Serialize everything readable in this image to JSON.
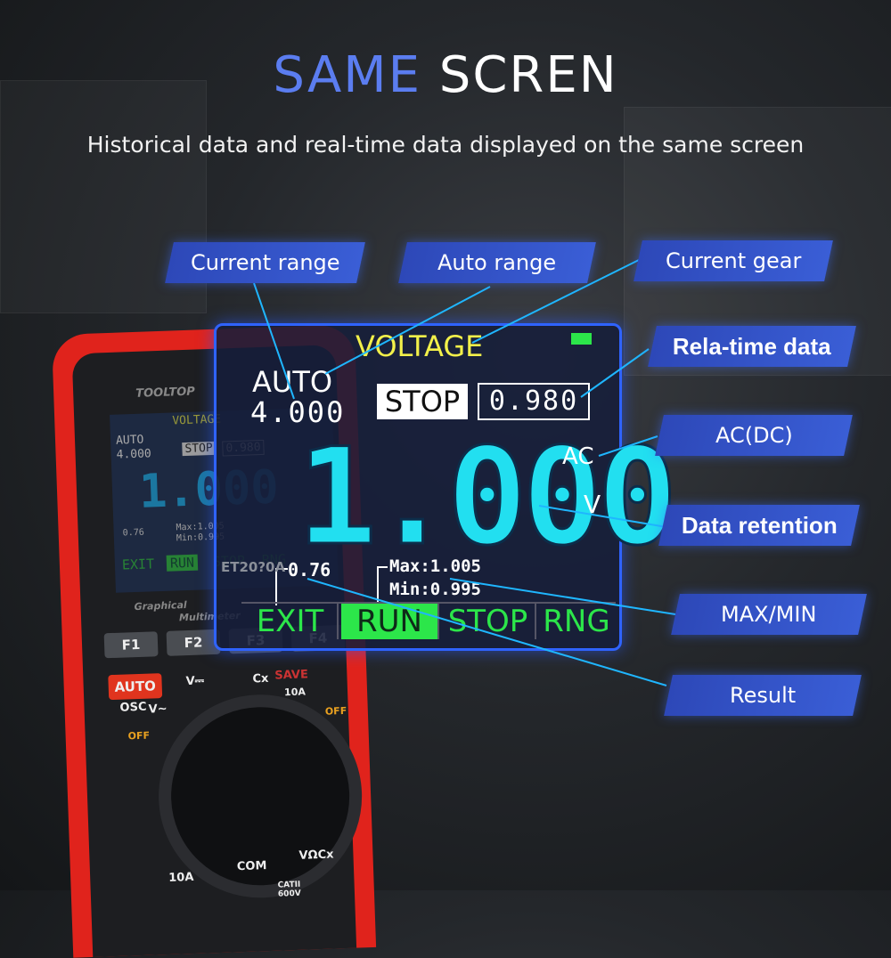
{
  "header": {
    "title_accent": "SAME",
    "title_main": "SCREN",
    "subtitle": "Historical data and real-time data displayed on the same screen"
  },
  "callouts": {
    "current_range": "Current range",
    "auto_range": "Auto range",
    "current_gear": "Current gear",
    "realtime_data": "Rela-time data",
    "ac_dc": "AC(DC)",
    "data_retention": "Data retention",
    "max_min": "MAX/MIN",
    "result": "Result"
  },
  "screen": {
    "mode": "VOLTAGE",
    "range_mode": "AUTO",
    "range_value": "4.000",
    "hold_state": "STOP",
    "realtime_value": "0.980",
    "main_reading": "1.000",
    "ac_label": "AC",
    "unit": "V",
    "result": "0.76",
    "max": "Max:1.005",
    "min": "Min:0.995",
    "function_keys": [
      "EXIT",
      "RUN",
      "STOP",
      "RNG"
    ],
    "battery_color": "#2ce64a",
    "accent": "#22dff0"
  },
  "meter": {
    "brand": "TOOLTOP",
    "caption1": "Graphical",
    "caption2": "Multimeter",
    "model": "ET20?0A",
    "keys": [
      "F1",
      "F2",
      "F3",
      "F4"
    ],
    "auto_key": "AUTO",
    "osc": "OSC",
    "save": "SAVE",
    "dial": [
      "V~",
      "V⎓",
      "Cx",
      "10A",
      "OFF",
      "OFF"
    ],
    "jacks": [
      "10A",
      "COM",
      "VΩCx"
    ],
    "cat": "CATII 600V",
    "body_color": "#e0231c"
  }
}
